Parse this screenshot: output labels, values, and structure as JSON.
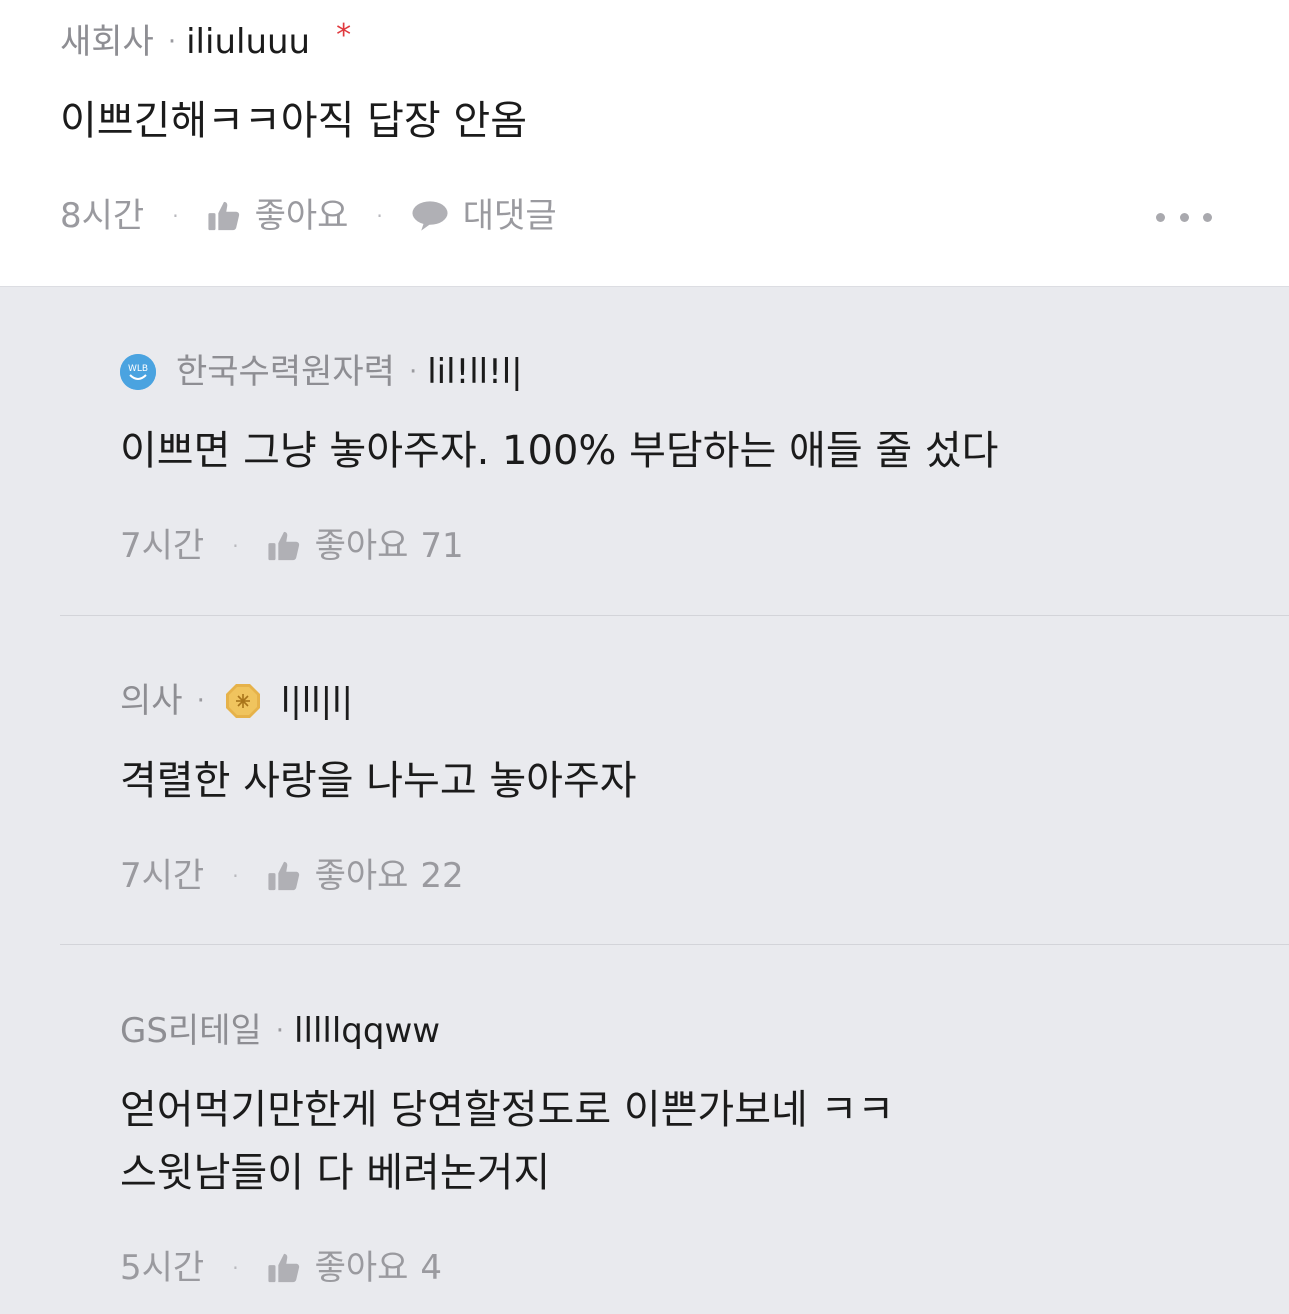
{
  "top_comment": {
    "company": "새회사",
    "separator": "·",
    "nickname": "iliuluuu",
    "required_mark": "*",
    "text": "이쁘긴해ㅋㅋ아직 답장 안옴",
    "time": "8시간",
    "like_label": "좋아요",
    "reply_label": "대댓글",
    "more_icon": "more-horizontal-icon"
  },
  "replies": [
    {
      "company": "한국수력원자력",
      "badge_icon": "wlb-badge-icon",
      "badge_text": "WLB",
      "separator": "·",
      "nickname": "lil!ll!l|",
      "lines": [
        "이쁘면 그냥 놓아주자. 100% 부담하는 애들 줄 섰다"
      ],
      "time": "7시간",
      "like_label": "좋아요",
      "like_count": "71"
    },
    {
      "company": "의사",
      "badge_icon": "gold-octagon-badge-icon",
      "separator": "·",
      "nickname": "l|ll|l|",
      "lines": [
        "격렬한 사랑을 나누고 놓아주자"
      ],
      "time": "7시간",
      "like_label": "좋아요",
      "like_count": "22"
    },
    {
      "company": "GS리테일",
      "separator": "·",
      "nickname": "lllllqqww",
      "lines": [
        "얻어먹기만한게 당연할정도로 이쁜가보네 ㅋㅋ",
        "스윗남들이 다 베려논거지"
      ],
      "time": "5시간",
      "like_label": "좋아요",
      "like_count": "4"
    }
  ],
  "colors": {
    "reply_background": "#e9eaee",
    "meta_gray": "#8e8e93",
    "required_red": "#e0393e",
    "wlb_blue": "#4aa3e0",
    "badge_gold": "#e6b24a"
  }
}
